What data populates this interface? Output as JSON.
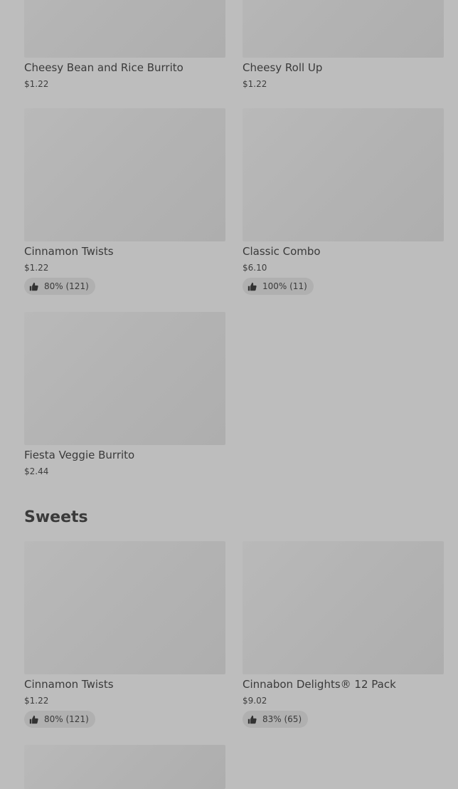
{
  "items_top": [
    {
      "name": "Cheesy Bean and Rice Burrito",
      "price": "$1.22"
    },
    {
      "name": "Cheesy Roll Up",
      "price": "$1.22"
    },
    {
      "name": "Cinnamon Twists",
      "price": "$1.22",
      "rating": "80% (121)"
    },
    {
      "name": "Classic Combo",
      "price": "$6.10",
      "rating": "100% (11)"
    },
    {
      "name": "Fiesta Veggie Burrito",
      "price": "$2.44"
    }
  ],
  "sweets": {
    "title": "Sweets",
    "items": [
      {
        "name": "Cinnamon Twists",
        "price": "$1.22",
        "rating": "80% (121)"
      },
      {
        "name": "Cinnabon Delights® 12 Pack",
        "price": "$9.02",
        "rating": "83% (65)"
      }
    ]
  },
  "icons": {
    "rating": "thumbs-up-icon"
  }
}
